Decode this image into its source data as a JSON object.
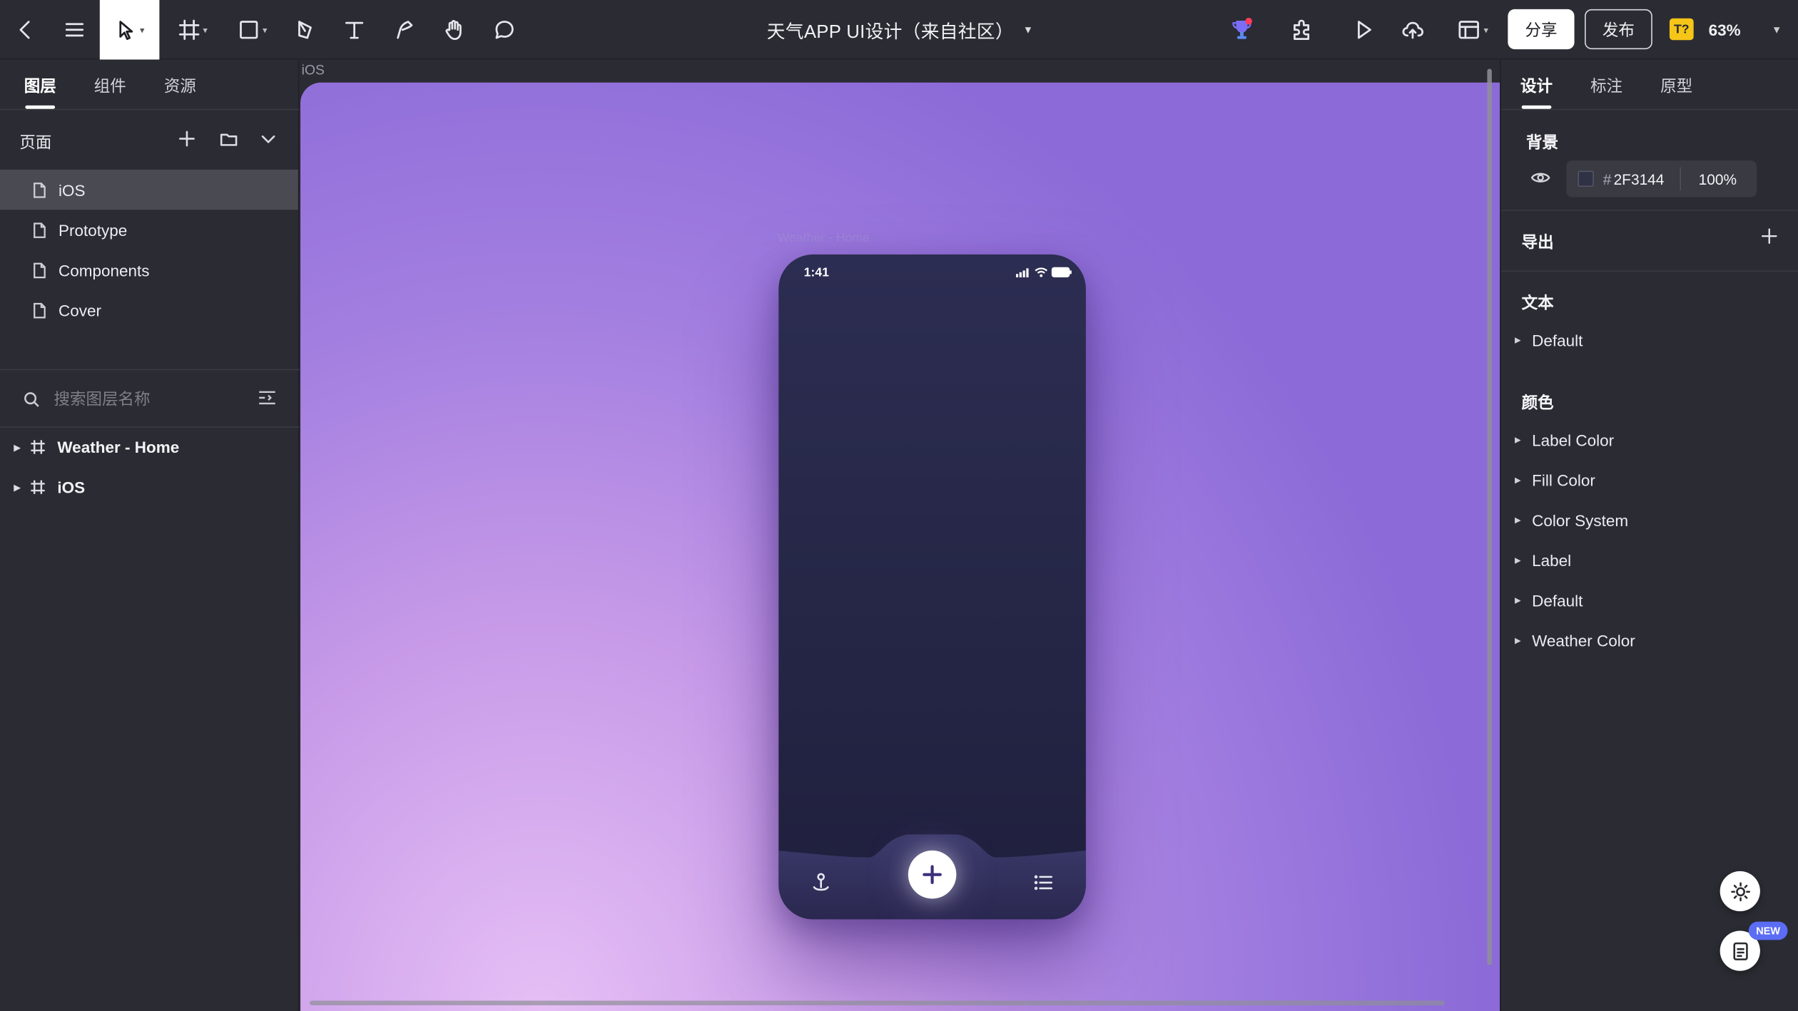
{
  "toolbar": {
    "title": "天气APP UI设计（来自社区）",
    "share_label": "分享",
    "publish_label": "发布",
    "font_badge": "T?",
    "zoom": "63%",
    "tools": [
      "back-icon",
      "menu-icon",
      "move-tool-icon",
      "frame-tool-icon",
      "shape-tool-icon",
      "pen-tool-icon",
      "text-tool-icon",
      "pencil-tool-icon",
      "hand-tool-icon",
      "comment-tool-icon"
    ],
    "right_icons": [
      "trophy-icon",
      "plugin-icon",
      "play-icon",
      "upload-icon",
      "layout-icon"
    ]
  },
  "left_panel": {
    "tabs": [
      {
        "label": "图层"
      },
      {
        "label": "组件"
      },
      {
        "label": "资源"
      }
    ],
    "pages_label": "页面",
    "pages": [
      {
        "label": "iOS"
      },
      {
        "label": "Prototype"
      },
      {
        "label": "Components"
      },
      {
        "label": "Cover"
      }
    ],
    "selected_page": "iOS",
    "search_placeholder": "搜索图层名称",
    "layers": [
      {
        "label": "Weather - Home"
      },
      {
        "label": "iOS"
      }
    ]
  },
  "canvas": {
    "page_label": "iOS",
    "frame_label": "Weather - Home",
    "phone": {
      "time": "1:41",
      "tab_icons": [
        "location-pin-icon",
        "plus-icon",
        "list-icon"
      ]
    },
    "colors": {
      "board_top": "#8c6bd8",
      "board_bottom": "#e6bff5",
      "phone_bg": "#262747"
    }
  },
  "right_panel": {
    "tabs": [
      {
        "label": "设计"
      },
      {
        "label": "标注"
      },
      {
        "label": "原型"
      }
    ],
    "background_label": "背景",
    "background_hash": "#",
    "background_hex": "2F3144",
    "background_opacity": "100%",
    "export_label": "导出",
    "text_label": "文本",
    "text_styles": [
      {
        "label": "Default"
      }
    ],
    "color_label": "颜色",
    "color_styles": [
      {
        "label": "Label Color"
      },
      {
        "label": "Fill Color"
      },
      {
        "label": "Color System"
      },
      {
        "label": "Label"
      },
      {
        "label": "Default"
      },
      {
        "label": "Weather Color"
      }
    ],
    "new_badge": "NEW"
  }
}
